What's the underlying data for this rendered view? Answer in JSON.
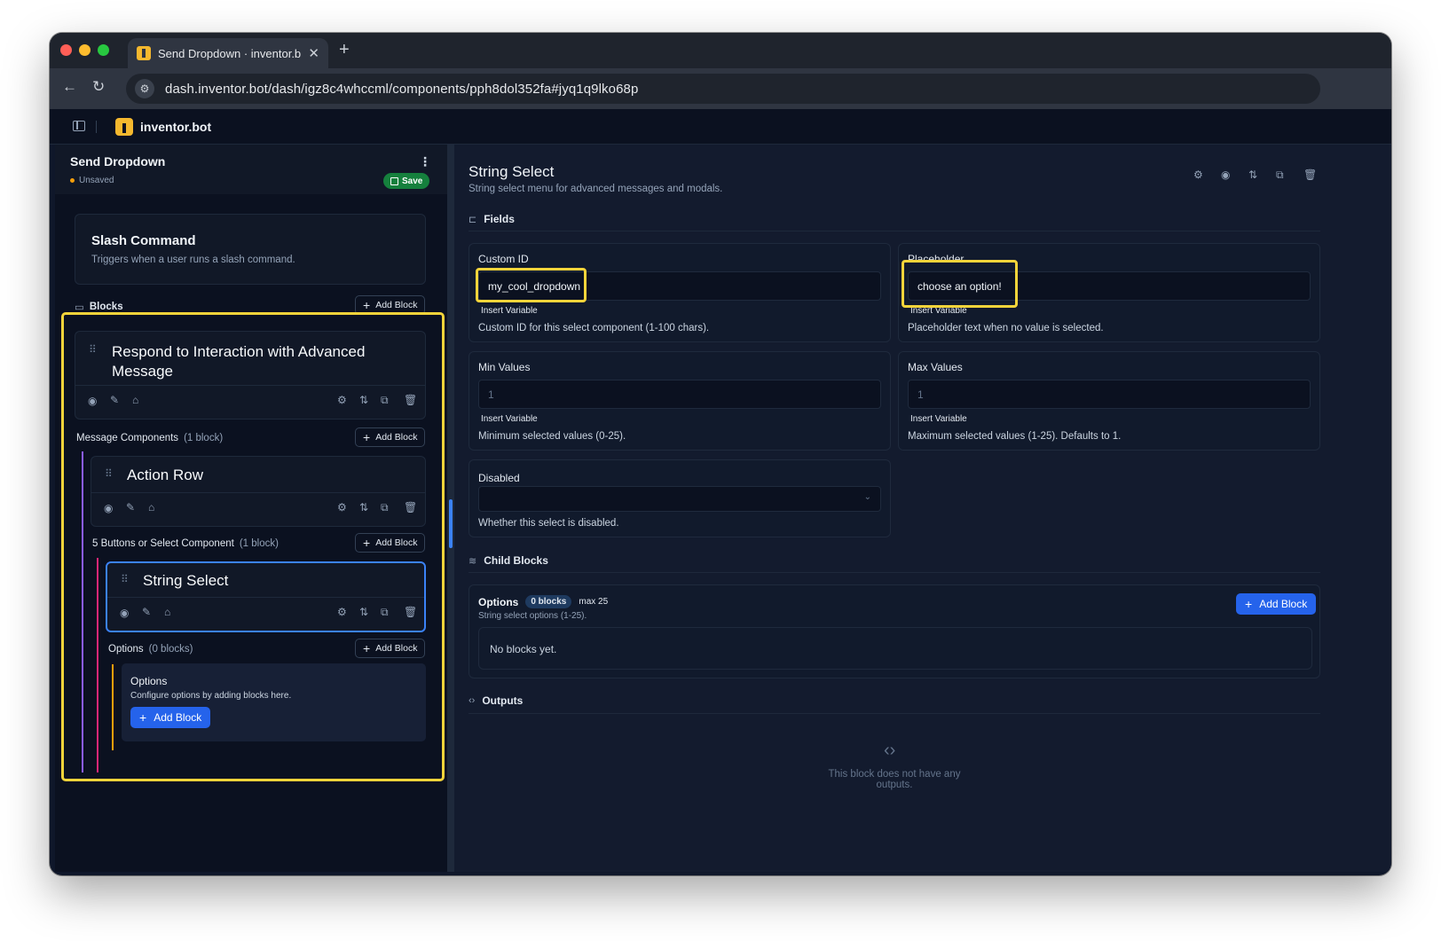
{
  "browser": {
    "tab_title": "Send Dropdown · inventor.bo",
    "tab_close": "✕",
    "new_tab": "+",
    "url": "dash.inventor.bot/dash/igz8c4whccml/components/pph8dol352fa#jyq1q9lko68p"
  },
  "app": {
    "brand": "inventor.bot",
    "document": {
      "title": "Send Dropdown",
      "status": "Unsaved",
      "save_label": "Save"
    },
    "trigger": {
      "title": "Slash Command",
      "description": "Triggers when a user runs a slash command."
    },
    "blocks_section": {
      "label": "Blocks",
      "add_label": "Add Block"
    },
    "tree": {
      "respond_block": {
        "title_line1": "Respond to Interaction with Advanced",
        "title_line2": "Message"
      },
      "message_components": {
        "label": "Message Components",
        "count": "(1 block)",
        "add_label": "Add Block"
      },
      "action_row": {
        "title": "Action Row"
      },
      "buttons_section": {
        "label": "5 Buttons or Select Component",
        "count": "(1 block)",
        "add_label": "Add Block"
      },
      "string_select": {
        "title": "String Select"
      },
      "options_section": {
        "label": "Options",
        "count": "(0 blocks)",
        "add_label": "Add Block"
      },
      "options_card": {
        "title": "Options",
        "description": "Configure options by adding blocks here.",
        "add_label": "Add Block"
      }
    },
    "detail": {
      "title": "String Select",
      "description": "String select menu for advanced messages and modals.",
      "fields_heading": "Fields",
      "fields": {
        "custom_id": {
          "label": "Custom ID",
          "value": "my_cool_dropdown",
          "insert": "Insert Variable",
          "help": "Custom ID for this select component (1-100 chars)."
        },
        "placeholder": {
          "label": "Placeholder",
          "value": "choose an option!",
          "insert": "Insert Variable",
          "help": "Placeholder text when no value is selected."
        },
        "min_values": {
          "label": "Min Values",
          "value": "1",
          "insert": "Insert Variable",
          "help": "Minimum selected values (0-25)."
        },
        "max_values": {
          "label": "Max Values",
          "value": "1",
          "insert": "Insert Variable",
          "help": "Maximum selected values (1-25). Defaults to 1."
        },
        "disabled": {
          "label": "Disabled",
          "value": "",
          "help": "Whether this select is disabled."
        }
      },
      "child_blocks_heading": "Child Blocks",
      "options": {
        "label": "Options",
        "badge": "0 blocks",
        "max": "max 25",
        "description": "String select options (1-25).",
        "add_label": "Add Block",
        "empty": "No blocks yet."
      },
      "outputs_heading": "Outputs",
      "outputs_empty": "This block does not have any outputs."
    }
  },
  "colors": {
    "highlight": "#f4d43a",
    "accent_blue": "#2563eb",
    "save_green": "#15803d",
    "unsaved_dot": "#f59e0b",
    "tree_line_purple": "#8b5cf6",
    "tree_line_pink": "#db2777",
    "tree_line_orange": "#f59e0b"
  },
  "icons": {
    "sidebar_toggle": "sidebar-icon",
    "folder": "folder-icon",
    "eye": "eye-icon",
    "edit": "pencil-icon",
    "pin": "pin-icon",
    "settings": "gear-icon",
    "move": "swap-icon",
    "copy": "copy-icon",
    "delete": "trash-icon",
    "code": "code-icon",
    "layers": "layers-icon"
  }
}
